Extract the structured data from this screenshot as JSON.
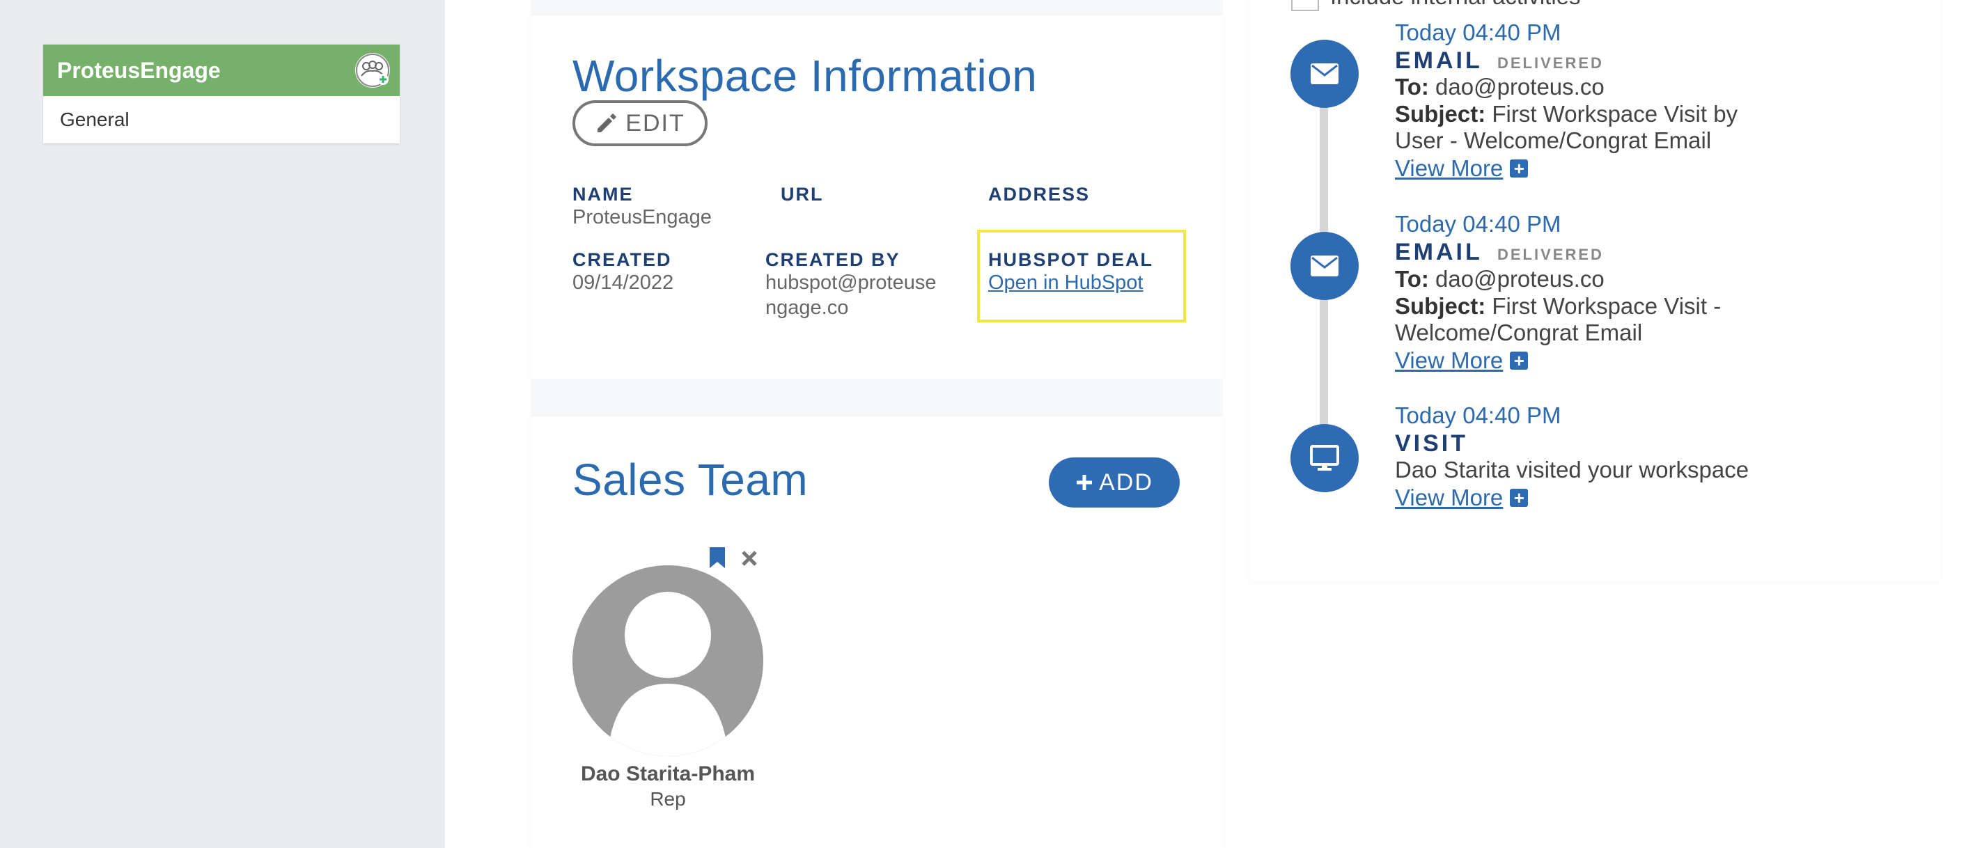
{
  "sidebar": {
    "workspace_name": "ProteusEngage",
    "items": [
      {
        "label": "General"
      }
    ]
  },
  "workspace_info": {
    "title": "Workspace Information",
    "edit_label": "EDIT",
    "fields": {
      "name_label": "NAME",
      "name_value": "ProteusEngage",
      "url_label": "URL",
      "address_label": "ADDRESS",
      "created_label": "CREATED",
      "created_value": "09/14/2022",
      "created_by_label": "CREATED BY",
      "created_by_value_line1": "hubspot@proteuse",
      "created_by_value_line2": "ngage.co",
      "hubspot_label": "HUBSPOT DEAL",
      "hubspot_link": "Open in HubSpot"
    }
  },
  "sales_team": {
    "title": "Sales Team",
    "add_label": "ADD",
    "members": [
      {
        "name": "Dao Starita-Pham",
        "role": "Rep"
      }
    ]
  },
  "activity": {
    "checkbox_label": "Include internal activities",
    "items": [
      {
        "time": "Today 04:40 PM",
        "type": "EMAIL",
        "status": "DELIVERED",
        "to_label": "To:",
        "to_value": "dao@proteus.co",
        "subject_label": "Subject:",
        "subject_line1": "First Workspace Visit by",
        "subject_line2": "User - Welcome/Congrat Email",
        "view_more": "View More"
      },
      {
        "time": "Today 04:40 PM",
        "type": "EMAIL",
        "status": "DELIVERED",
        "to_label": "To:",
        "to_value": "dao@proteus.co",
        "subject_label": "Subject:",
        "subject_line1": "First Workspace Visit -",
        "subject_line2": "Welcome/Congrat Email",
        "view_more": "View More"
      },
      {
        "time": "Today 04:40 PM",
        "type": "VISIT",
        "description": "Dao Starita visited your workspace",
        "view_more": "View More"
      }
    ]
  },
  "colors": {
    "accent": "#2f6bb2",
    "brand_green": "#76b06b",
    "highlight": "#f2e648"
  }
}
